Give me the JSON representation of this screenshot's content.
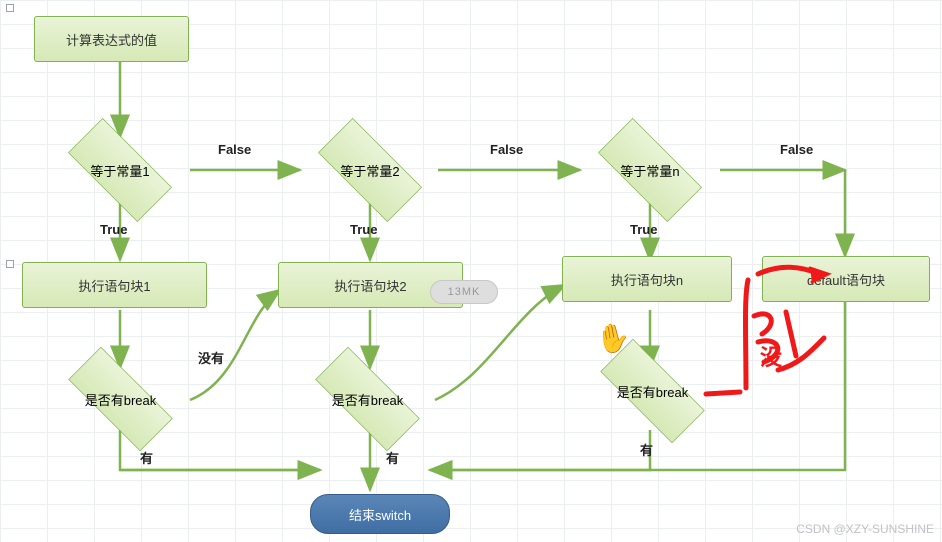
{
  "nodes": {
    "start": {
      "label": "计算表达式的值"
    },
    "cond1": {
      "label": "等于常量1"
    },
    "cond2": {
      "label": "等于常量2"
    },
    "condn": {
      "label": "等于常量n"
    },
    "exec1": {
      "label": "执行语句块1"
    },
    "exec2": {
      "label": "执行语句块2"
    },
    "execn": {
      "label": "执行语句块n"
    },
    "default": {
      "label": "default语句块"
    },
    "break1": {
      "label": "是否有break"
    },
    "break2": {
      "label": "是否有break"
    },
    "breakn": {
      "label": "是否有break"
    },
    "end": {
      "label": "结束switch"
    }
  },
  "edge_labels": {
    "false1": "False",
    "false2": "False",
    "falsen": "False",
    "true1": "True",
    "true2": "True",
    "truen": "True",
    "no1": "没有",
    "yes1": "有",
    "yes2": "有",
    "yesn": "有"
  },
  "annotations": {
    "red_text": "没",
    "pill_text": "13MK",
    "cursor": "hand"
  },
  "watermark": "CSDN @XZY-SUNSHINE"
}
